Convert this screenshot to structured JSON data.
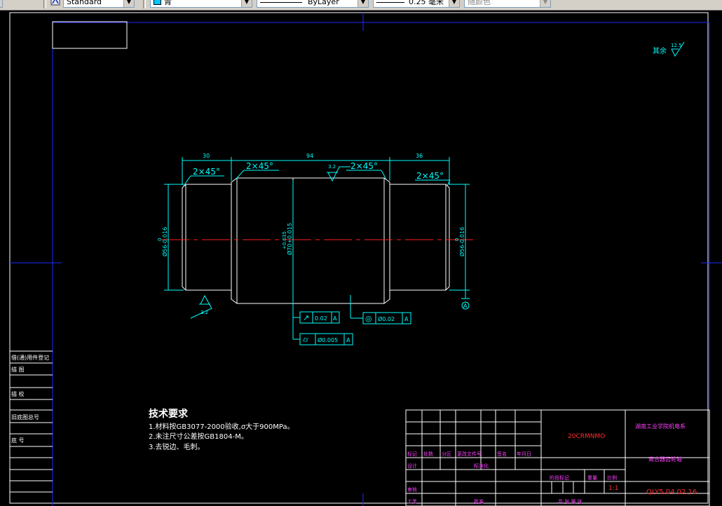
{
  "toolbar": {
    "style_combo": "Standard",
    "layer_combo": "青",
    "linetype_combo": "ByLayer",
    "lineweight_combo": "0.25 毫米",
    "color_combo": "随颜色"
  },
  "drawing": {
    "roughness_note": {
      "label": "其余",
      "value": "12.5"
    },
    "dimensions": {
      "len_left": "30",
      "len_mid": "94",
      "len_right": "36",
      "chamfer_1": "2×45°",
      "chamfer_2": "2×45°",
      "chamfer_3": "2×45°",
      "chamfer_4": "2×45°",
      "dia_left": "Ø56-0.016",
      "dia_left_tol": "0",
      "dia_mid": "Ø70+0.015",
      "dia_mid_tol": "+0.035",
      "dia_right": "Ø56-0.016",
      "dia_right_tol": "0",
      "rough_top": "3.2",
      "rough_bottom": "3.2",
      "datum": "A"
    },
    "gdt": [
      {
        "symbol": "↗",
        "value": "0.02",
        "datum": "A"
      },
      {
        "symbol": "◎",
        "value": "Ø0.02",
        "datum": "A"
      },
      {
        "symbol": "⌭",
        "value": "Ø0.005",
        "datum": "A"
      }
    ],
    "tech_req": {
      "title": "技术要求",
      "lines": [
        "1.材料按GB3077-2000验收,σ大于900MPa。",
        "2.未注尺寸公差按GB1804-M。",
        "3.去锐边、毛刺。"
      ]
    },
    "side_table": [
      "借(通)用件登记",
      "描 图",
      "描 校",
      "旧底图总号",
      "底 号"
    ],
    "title_block": {
      "material": "20CRMNMO",
      "company": "湖南工业学院机电系",
      "part_name": "离合器齿轮轴",
      "scale": "1:1",
      "drawing_no": "QLY5.04.02.16",
      "row_labels_1": [
        "标记",
        "处数",
        "分区",
        "更改文件号",
        "签名",
        "年月日"
      ],
      "row_labels_2": [
        "设计",
        "标准化"
      ],
      "row_labels_3": [
        "阶段标记",
        "重量",
        "比例"
      ],
      "row_labels_4": [
        "审核"
      ],
      "row_labels_5": [
        "工艺",
        "批准"
      ],
      "sheet_text": "共  张  第  张"
    }
  }
}
